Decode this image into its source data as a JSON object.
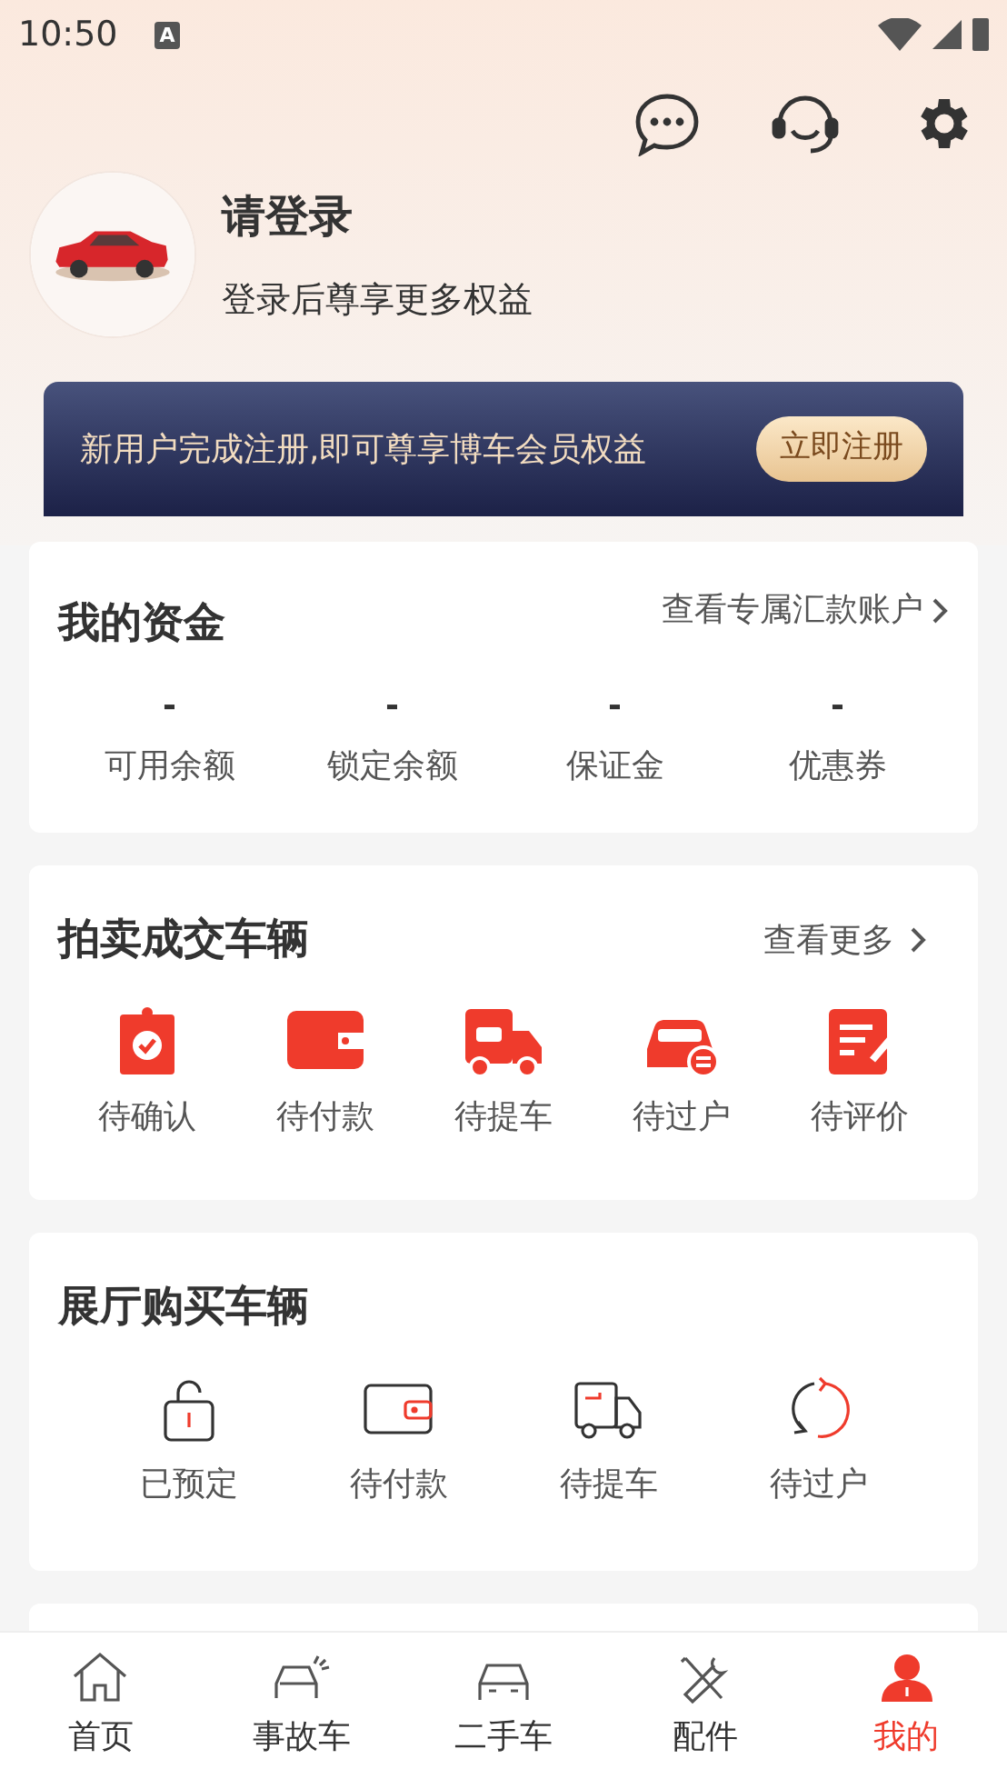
{
  "status_bar": {
    "time": "10:50",
    "notification": "A"
  },
  "header": {
    "title": "请登录",
    "subtitle": "登录后尊享更多权益"
  },
  "banner": {
    "text": "新用户完成注册,即可尊享博车会员权益",
    "button": "立即注册"
  },
  "funds": {
    "title": "我的资金",
    "link": "查看专属汇款账户",
    "items": [
      {
        "value": "-",
        "label": "可用余额"
      },
      {
        "value": "-",
        "label": "锁定余额"
      },
      {
        "value": "-",
        "label": "保证金"
      },
      {
        "value": "-",
        "label": "优惠券"
      }
    ]
  },
  "auction": {
    "title": "拍卖成交车辆",
    "link": "查看更多",
    "items": [
      {
        "kind": "confirm",
        "label": "待确认"
      },
      {
        "kind": "wallet",
        "label": "待付款"
      },
      {
        "kind": "truck",
        "label": "待提车"
      },
      {
        "kind": "transfer",
        "label": "待过户"
      },
      {
        "kind": "review",
        "label": "待评价"
      }
    ]
  },
  "showroom": {
    "title": "展厅购买车辆",
    "items": [
      {
        "kind": "lock",
        "label": "已预定"
      },
      {
        "kind": "wallet",
        "label": "待付款"
      },
      {
        "kind": "truck",
        "label": "待提车"
      },
      {
        "kind": "transfer",
        "label": "待过户"
      }
    ]
  },
  "tab_bar": [
    {
      "kind": "home",
      "label": "首页",
      "selected": false
    },
    {
      "kind": "accident",
      "label": "事故车",
      "selected": false
    },
    {
      "kind": "car",
      "label": "二手车",
      "selected": false
    },
    {
      "kind": "tools",
      "label": "配件",
      "selected": false
    },
    {
      "kind": "me",
      "label": "我的",
      "selected": true
    }
  ]
}
